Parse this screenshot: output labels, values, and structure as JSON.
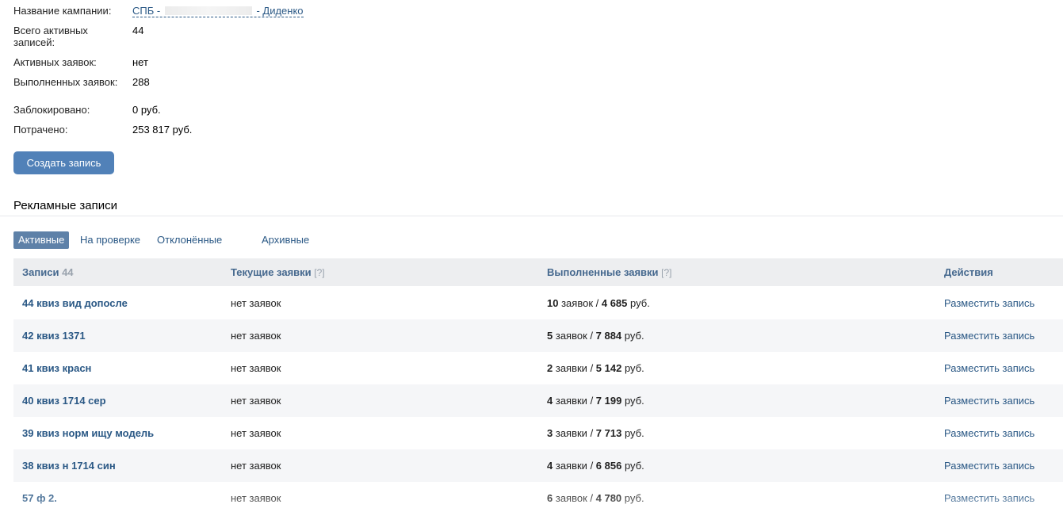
{
  "info": {
    "campaign_label": "Название кампании:",
    "campaign_prefix": "СПБ -",
    "campaign_suffix": "- Диденко",
    "total_label": "Всего активных записей:",
    "total_value": "44",
    "active_requests_label": "Активных заявок:",
    "active_requests_value": "нет",
    "completed_label": "Выполненных заявок:",
    "completed_value": "288",
    "blocked_label": "Заблокировано:",
    "blocked_value": "0 руб.",
    "spent_label": "Потрачено:",
    "spent_value": "253 817 руб."
  },
  "create_button": "Создать запись",
  "section_title": "Рекламные записи",
  "tabs": [
    {
      "label": "Активные",
      "active": true
    },
    {
      "label": "На проверке",
      "active": false
    },
    {
      "label": "Отклонённые",
      "active": false
    },
    {
      "label": "Архивные",
      "active": false
    }
  ],
  "table": {
    "headers": {
      "records": "Записи",
      "records_count": "44",
      "current": "Текущие заявки",
      "current_hint": "[?]",
      "completed": "Выполненные заявки",
      "completed_hint": "[?]",
      "actions": "Действия"
    },
    "rows": [
      {
        "name": "44 квиз вид допосле",
        "current": "нет заявок",
        "done_count": "10",
        "done_word": "заявок",
        "done_sum": "4 685",
        "currency": "руб.",
        "action": "Разместить запись"
      },
      {
        "name": "42 квиз 1371",
        "current": "нет заявок",
        "done_count": "5",
        "done_word": "заявок",
        "done_sum": "7 884",
        "currency": "руб.",
        "action": "Разместить запись"
      },
      {
        "name": "41 квиз красн",
        "current": "нет заявок",
        "done_count": "2",
        "done_word": "заявки",
        "done_sum": "5 142",
        "currency": "руб.",
        "action": "Разместить запись"
      },
      {
        "name": "40 квиз 1714 сер",
        "current": "нет заявок",
        "done_count": "4",
        "done_word": "заявки",
        "done_sum": "7 199",
        "currency": "руб.",
        "action": "Разместить запись"
      },
      {
        "name": "39 квиз норм ищу модель",
        "current": "нет заявок",
        "done_count": "3",
        "done_word": "заявки",
        "done_sum": "7 713",
        "currency": "руб.",
        "action": "Разместить запись"
      },
      {
        "name": "38 квиз н 1714 син",
        "current": "нет заявок",
        "done_count": "4",
        "done_word": "заявки",
        "done_sum": "6 856",
        "currency": "руб.",
        "action": "Разместить запись"
      },
      {
        "name": "57 ф 2.",
        "current": "нет заявок",
        "done_count": "6",
        "done_word": "заявок",
        "done_sum": "4 780",
        "currency": "руб.",
        "action": "Разместить запись"
      }
    ]
  },
  "colors": {
    "link": "#2a5885",
    "button_bg": "#5181b8",
    "tab_active_bg": "#5e81a8",
    "table_header_bg": "#edeef0",
    "row_alt_bg": "#f5f6f8"
  }
}
